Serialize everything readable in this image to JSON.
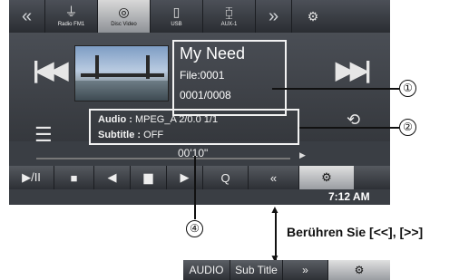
{
  "top_bar": {
    "prev_label": "«",
    "sources": [
      {
        "label": "Radio FM1",
        "icon": "antenna-icon",
        "glyph": "⏚"
      },
      {
        "label": "Disc Video",
        "icon": "disc-icon",
        "glyph": "◎"
      },
      {
        "label": "USB",
        "icon": "usb-icon",
        "glyph": "▯"
      },
      {
        "label": "AUX-1",
        "icon": "aux-icon",
        "glyph": "⧮"
      }
    ],
    "next_label": "»",
    "setup_glyph": "⚙"
  },
  "track": {
    "title": "My Need",
    "file": "File:0001",
    "position": "0001/0008"
  },
  "audio_info": {
    "audio_label": "Audio :",
    "audio_value": "MPEG_A  2/0.0  1/1",
    "subtitle_label": "Subtitle :",
    "subtitle_value": "OFF"
  },
  "progress": {
    "elapsed": "00'10\""
  },
  "controls": {
    "play_pause": "▶/II",
    "stop": "■",
    "prev": "◀",
    "folder": "▆",
    "next": "▶",
    "search": "Q",
    "back": "«",
    "setup_glyph": "⚙"
  },
  "clock": "7:12 AM",
  "callouts": {
    "one": "①",
    "two": "②",
    "four": "④"
  },
  "note": "Berühren Sie [<<], [>>]",
  "sub_bar": {
    "audio": "AUDIO",
    "subtitle": "Sub Title",
    "more": "»",
    "setup_glyph": "⚙"
  }
}
